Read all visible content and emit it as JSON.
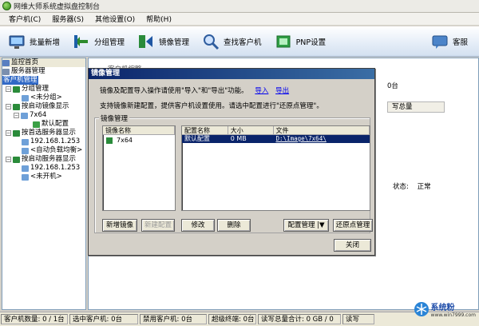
{
  "window": {
    "title": "网维大师系统虚拟盘控制台"
  },
  "menu": [
    {
      "label": "客户机(C)"
    },
    {
      "label": "服务器(S)"
    },
    {
      "label": "其他设置(O)"
    },
    {
      "label": "帮助(H)"
    }
  ],
  "toolbar": {
    "items": [
      {
        "label": "批量新增",
        "icon": "batch-add-icon"
      },
      {
        "label": "分组管理",
        "icon": "group-icon"
      },
      {
        "label": "镜像管理",
        "icon": "image-manage-icon"
      },
      {
        "label": "查找客户机",
        "icon": "find-client-icon"
      },
      {
        "label": "PNP设置",
        "icon": "pnp-icon"
      }
    ],
    "right": {
      "label": "客服",
      "icon": "support-icon"
    }
  },
  "tree": {
    "nodes": [
      {
        "label": "监控首页"
      },
      {
        "label": "服务器管理"
      },
      {
        "label": "客户机管理"
      },
      {
        "label": "分组管理"
      },
      {
        "label": "<未分组>"
      },
      {
        "label": "按启动镜像显示"
      },
      {
        "label": "7x64"
      },
      {
        "label": "默认配置"
      },
      {
        "label": "按首选服务器显示"
      },
      {
        "label": "192.168.1.253"
      },
      {
        "label": "<自动负载均衡>"
      },
      {
        "label": "按启动服务器显示"
      },
      {
        "label": "192.168.1.253"
      },
      {
        "label": "<未开机>"
      }
    ]
  },
  "background": {
    "tab_label": "客户机缩略",
    "right_text": "0台",
    "header_cell": "写总量",
    "status_label": "状态:",
    "status_value": "正常"
  },
  "dialog": {
    "title": "镜像管理",
    "line1": "镜像及配置导入操作请使用\"导入\"和\"导出\"功能。",
    "import_link": "导入",
    "export_link": "导出",
    "line2": "支持镜像新建配置，提供客户机设置使用。请选中配置进行\"还原点管理\"。",
    "group_label": "镜像管理",
    "image_list": {
      "header": "镜像名称",
      "items": [
        {
          "name": "7x64"
        }
      ]
    },
    "config_list": {
      "headers": [
        "配置名称",
        "大小",
        "文件"
      ],
      "rows": [
        {
          "name": "默认配置",
          "size": "0 MB",
          "file": "D:\\Image\\7x64\\"
        }
      ]
    },
    "buttons": {
      "new_image": "新增镜像",
      "new_config": "新建配置",
      "modify": "修改",
      "delete": "删除",
      "config_manage": "配置管理 |▼",
      "restore_manage": "还原点管理",
      "close": "关闭"
    }
  },
  "statusbar": [
    "客户机数量: 0 / 1台",
    "选中客户机: 0台",
    "禁用客户机: 0台",
    "超级终端: 0台",
    "读写总量合计: 0 GB / 0 GB",
    "读写"
  ],
  "watermark": {
    "text": "系统粉",
    "sub": "www.win7999.com"
  }
}
